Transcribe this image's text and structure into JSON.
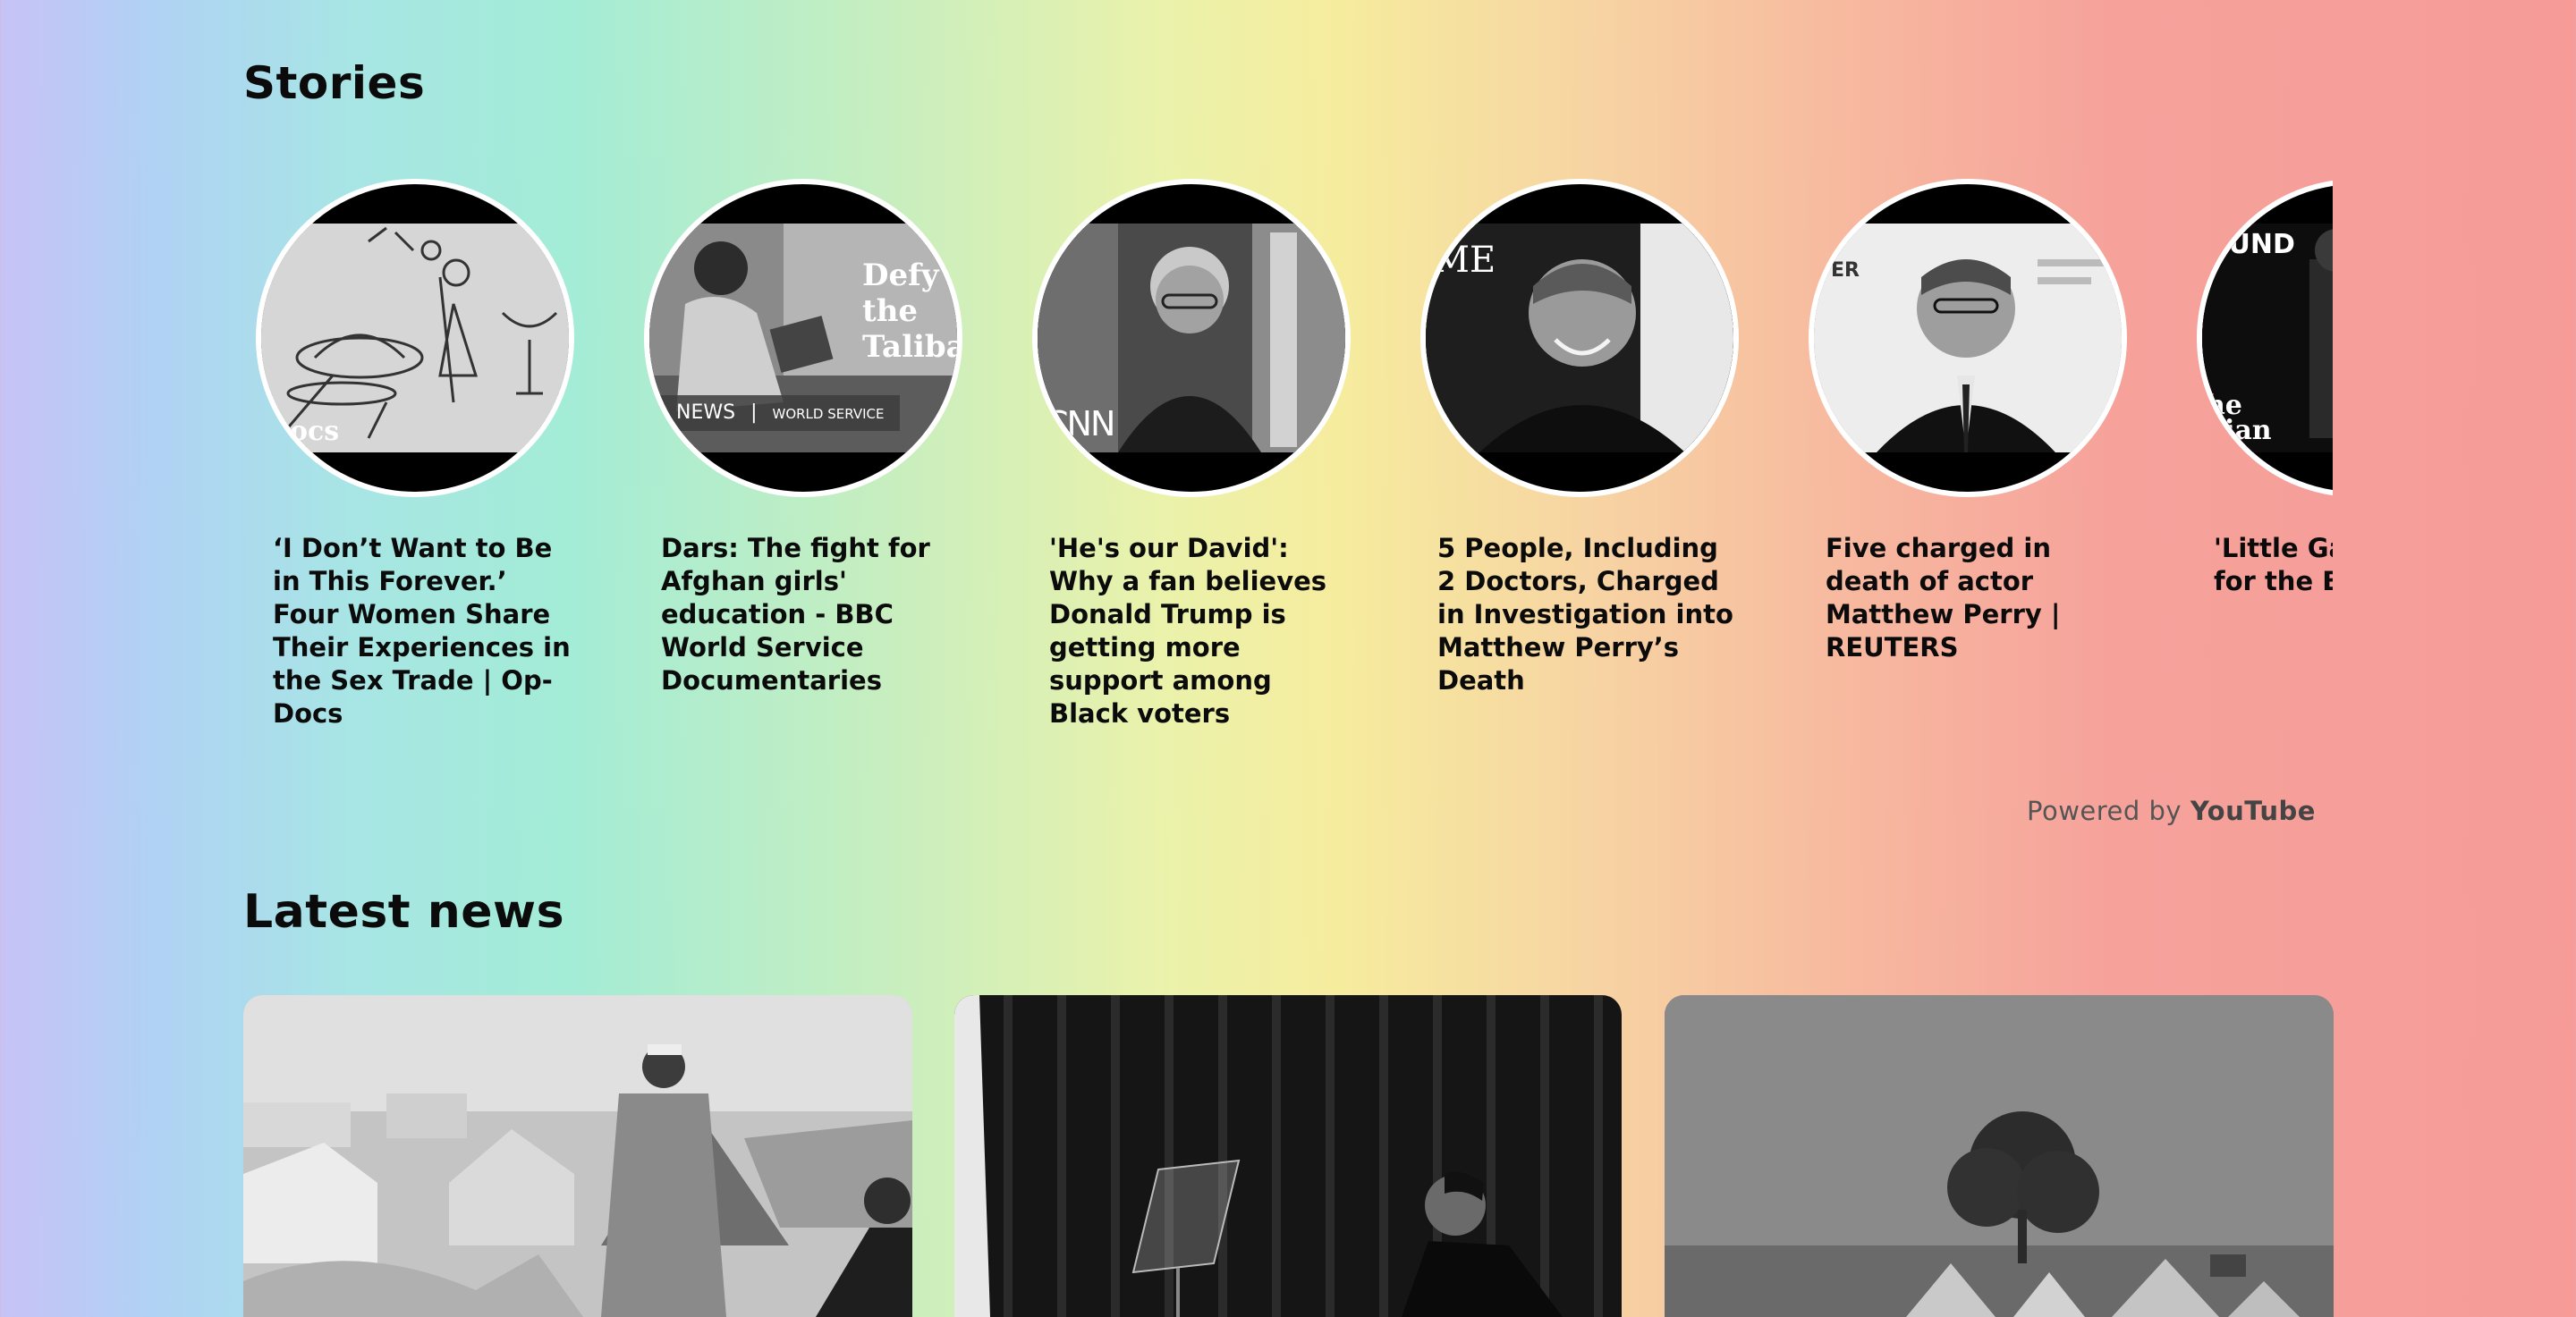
{
  "stories": {
    "title": "Stories",
    "items": [
      {
        "title": "‘I Don’t Want to Be in This Forever.’ Four Women Share Their Experiences in the Sex Trade | Op-Docs",
        "overlay": "Docs"
      },
      {
        "title": "Dars: The fight for Afghan girls' education - BBC World Service Documentaries",
        "overlay": "Defy the Taliba",
        "badge_news": "NEWS",
        "badge_service": "WORLD SERVICE"
      },
      {
        "title": "'He's our David': Why a fan believes Donald Trump is getting more support among Black voters",
        "overlay": "CNN"
      },
      {
        "title": "5 People, Including 2 Doctors, Charged in Investigation into Matthew Perry’s Death",
        "overlay": "ME"
      },
      {
        "title": "Five charged in death of actor Matthew Perry | REUTERS",
        "overlay": "TER"
      },
      {
        "title": "'Little Gaza' fight for the Bank",
        "overlay": "OUND",
        "overlay2": "he dian"
      }
    ]
  },
  "powered": {
    "prefix": "Powered by",
    "brand": "YouTube"
  },
  "latest_news": {
    "title": "Latest news",
    "cards": [
      {
        "kind": "photo",
        "subject": "tents-camp"
      },
      {
        "kind": "photo",
        "subject": "podium-curtain"
      },
      {
        "kind": "photo",
        "subject": "tree-tents"
      }
    ]
  }
}
